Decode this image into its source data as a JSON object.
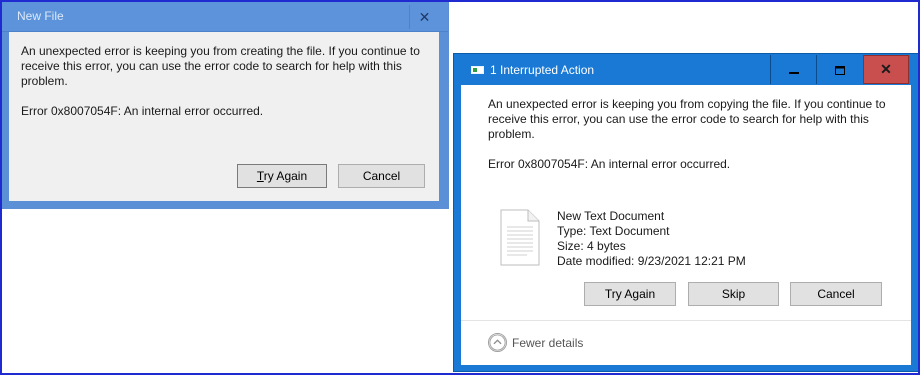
{
  "dialog_new_file": {
    "title": "New File",
    "close_icon": "close-icon",
    "message": "An unexpected error is keeping you from creating the file. If you continue to receive this error, you can use the error code to search for help with this problem.",
    "error_line": "Error 0x8007054F: An internal error occurred.",
    "try_again_mnemonic": "T",
    "try_again_rest": "ry Again",
    "cancel_label": "Cancel"
  },
  "dialog_interrupted": {
    "title": "1 Interrupted Action",
    "app_icon": "file-copy-icon",
    "minimize_icon": "minimize-icon",
    "maximize_icon": "maximize-icon",
    "close_icon": "close-icon",
    "message": "An unexpected error is keeping you from copying the file. If you continue to receive this error, you can use the error code to search for help with this problem.",
    "error_line": "Error 0x8007054F: An internal error occurred.",
    "file": {
      "icon": "text-document-icon",
      "name": "New Text Document",
      "type": "Type: Text Document",
      "size": "Size: 4 bytes",
      "date_modified": "Date modified: 9/23/2021 12:21 PM"
    },
    "try_again_label": "Try Again",
    "skip_label": "Skip",
    "cancel_label": "Cancel",
    "details_toggle_label": "Fewer details",
    "details_toggle_icon": "chevron-up-icon"
  },
  "colors": {
    "frame_border": "#1f2bd0",
    "inactive_title": "#5d93da",
    "active_title": "#1979d4",
    "close_hover": "#c94f4f"
  }
}
